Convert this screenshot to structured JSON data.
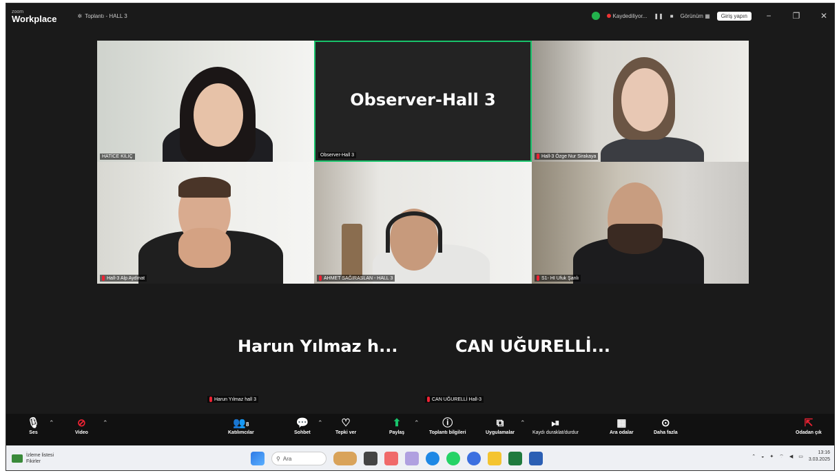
{
  "titlebar": {
    "brand_small": "zoom",
    "brand_big": "Workplace",
    "meeting_title": "Toplantı - HALL 3",
    "recording": "Kaydediliyor...",
    "view": "Görünüm",
    "signin": "Giriş yapın",
    "min": "−",
    "max": "❐",
    "close": "✕"
  },
  "tiles": [
    {
      "name": "HATİCE KILIÇ"
    },
    {
      "name": "Observer-Hall 3",
      "big": "Observer-Hall 3"
    },
    {
      "name": "Hall-3 Özge Nur Sirakaya"
    },
    {
      "name": "Hall-3 Alp Aydınat"
    },
    {
      "name": "AHMET SAĞIRASLAN - HALL 3"
    },
    {
      "name": "S1- HI Ufuk Şanlı"
    }
  ],
  "bottom_participants": [
    {
      "big": "Harun Yılmaz h...",
      "small": "Harun Yılmaz hall 3"
    },
    {
      "big": "CAN  UĞURELLİ...",
      "small": "CAN UĞURELLİ Hall-3"
    }
  ],
  "toolbar": {
    "audio": "Ses",
    "video": "Video",
    "participants": "Katılımcılar",
    "participants_count": "8",
    "chat": "Sohbet",
    "react": "Tepki ver",
    "share": "Paylaş",
    "info": "Toplantı bilgileri",
    "apps": "Uygulamalar",
    "record": "Kaydı duraklat/durdur",
    "breakout": "Ara odalar",
    "more": "Daha fazla",
    "leave": "Odadan çık"
  },
  "taskbar": {
    "weather_title": "İzleme listesi",
    "weather_sub": "Fikirler",
    "search": "Ara",
    "time": "13:16",
    "date": "3.03.2025"
  }
}
